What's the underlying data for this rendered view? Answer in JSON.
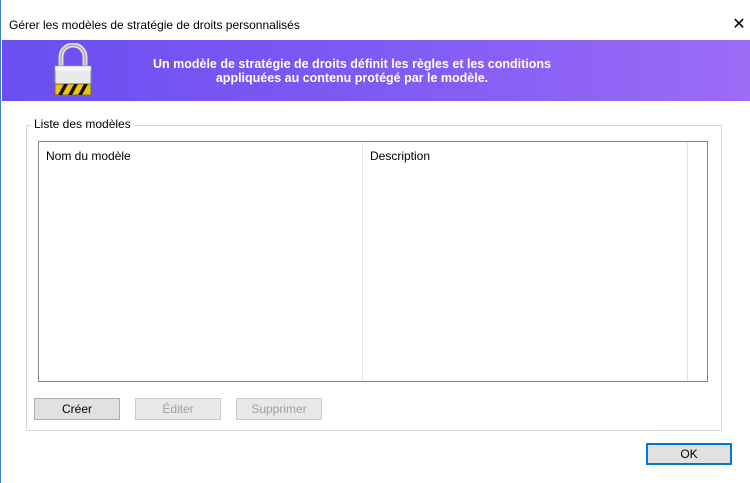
{
  "window": {
    "title": "Gérer les modèles de stratégie de droits personnalisés",
    "close_glyph": "✕"
  },
  "banner": {
    "icon": "padlock-icon",
    "line1": "Un modèle de stratégie de droits définit les règles et les conditions",
    "line2": "appliquées au contenu protégé par le modèle."
  },
  "templates_group": {
    "label": "Liste des modèles",
    "columns": [
      "Nom du modèle",
      "Description"
    ],
    "rows": []
  },
  "buttons": {
    "create": "Créer",
    "edit": "Éditer",
    "delete": "Supprimer",
    "ok": "OK"
  },
  "colors": {
    "banner_start": "#6a4ef0",
    "banner_end": "#9b6cf6",
    "accent": "#0078d7"
  }
}
